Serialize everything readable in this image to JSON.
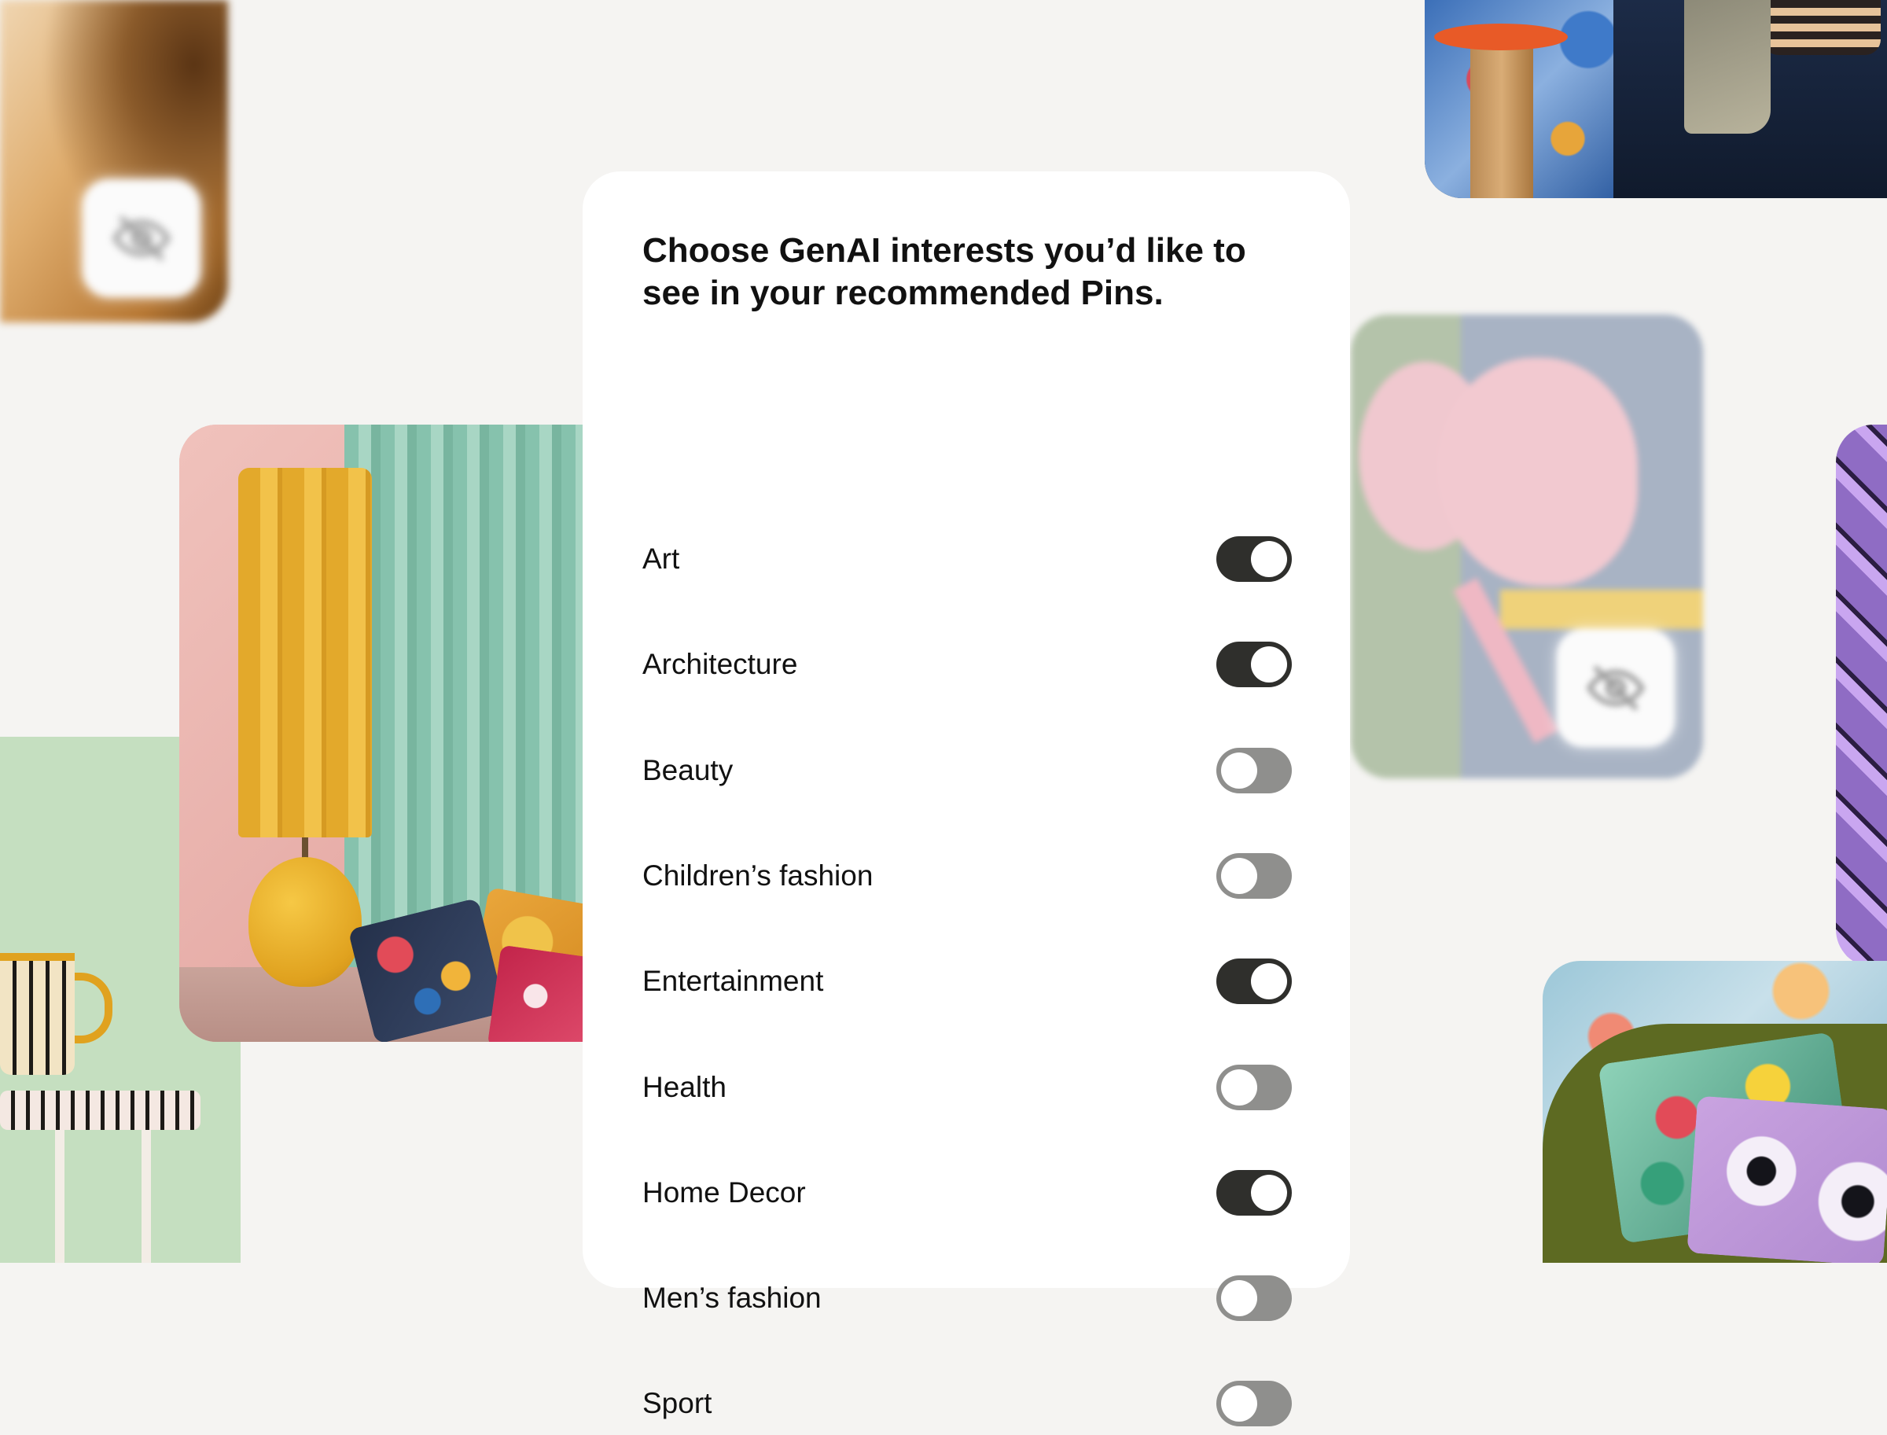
{
  "dialog": {
    "title": "Choose GenAI interests you’d like to see in your recommended Pins.",
    "interests": [
      {
        "label": "Art",
        "enabled": true
      },
      {
        "label": "Architecture",
        "enabled": true
      },
      {
        "label": "Beauty",
        "enabled": false
      },
      {
        "label": "Children’s fashion",
        "enabled": false
      },
      {
        "label": "Entertainment",
        "enabled": true
      },
      {
        "label": "Health",
        "enabled": false
      },
      {
        "label": "Home Decor",
        "enabled": true
      },
      {
        "label": "Men’s fashion",
        "enabled": false
      },
      {
        "label": "Sport",
        "enabled": false
      }
    ]
  },
  "colors": {
    "background": "#f5f4f2",
    "card": "#ffffff",
    "toggle_on": "#2f2f2c",
    "toggle_off": "#8f8f8d"
  },
  "icons": {
    "hidden_badge": "eye-off-icon"
  }
}
